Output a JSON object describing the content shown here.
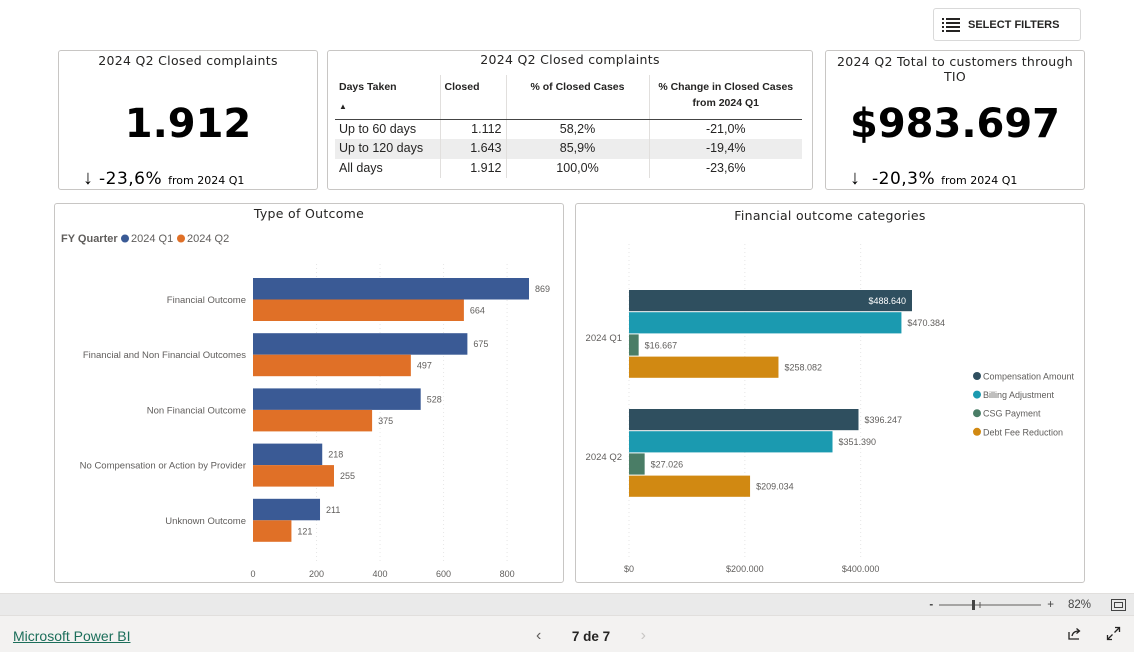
{
  "toolbar": {
    "filters_label": "SELECT FILTERS",
    "filters_icon": "list-icon"
  },
  "kpi_closed": {
    "title": "2024 Q2 Closed complaints",
    "value": "1.912",
    "arrow": "↓",
    "delta": "-23,6%",
    "from": "from 2024 Q1"
  },
  "table": {
    "title": "2024 Q2 Closed complaints",
    "headers": [
      "Days Taken",
      "Closed",
      "% of Closed Cases",
      "% Change in Closed Cases from 2024 Q1"
    ],
    "rows": [
      [
        "Up to 60 days",
        "1.112",
        "58,2%",
        "-21,0%"
      ],
      [
        "Up to 120 days",
        "1.643",
        "85,9%",
        "-19,4%"
      ],
      [
        "All days",
        "1.912",
        "100,0%",
        "-23,6%"
      ]
    ]
  },
  "kpi_tio": {
    "title": "2024 Q2 Total to customers through TIO",
    "value": "$983.697",
    "arrow": "↓",
    "delta": "-20,3%",
    "from": "from 2024 Q1"
  },
  "chart_data": [
    {
      "type": "bar",
      "orientation": "horizontal",
      "title": "Type of Outcome",
      "legend_title": "FY Quarter",
      "legend_position": "top-left",
      "categories": [
        "Financial Outcome",
        "Financial and Non Financial Outcomes",
        "Non Financial Outcome",
        "No Compensation or Action by Provider",
        "Unknown Outcome"
      ],
      "series": [
        {
          "name": "2024 Q1",
          "color": "#3a5a95",
          "values": [
            869,
            675,
            528,
            218,
            211
          ]
        },
        {
          "name": "2024 Q2",
          "color": "#e07027",
          "values": [
            664,
            497,
            375,
            255,
            121
          ]
        }
      ],
      "data_labels": [
        [
          "869",
          "675",
          "528",
          "218",
          "211"
        ],
        [
          "664",
          "497",
          "375",
          "255",
          "121"
        ]
      ],
      "xticks": [
        "0",
        "200",
        "400",
        "600",
        "800"
      ],
      "xtick_values": [
        0,
        200,
        400,
        600,
        800
      ],
      "xlim": [
        0,
        869
      ],
      "grid": true
    },
    {
      "type": "bar",
      "orientation": "horizontal",
      "title": "Financial outcome categories",
      "legend_position": "right",
      "categories": [
        "2024 Q1",
        "2024 Q2"
      ],
      "series": [
        {
          "name": "Compensation Amount",
          "color": "#2f4f5f",
          "values": [
            488640,
            396247
          ]
        },
        {
          "name": "Billing Adjustment",
          "color": "#1b9ab0",
          "values": [
            470384,
            351390
          ]
        },
        {
          "name": "CSG Payment",
          "color": "#4a7d66",
          "values": [
            16667,
            27026
          ]
        },
        {
          "name": "Debt Fee Reduction",
          "color": "#d18912",
          "values": [
            258082,
            209034
          ]
        }
      ],
      "data_labels": [
        [
          "$488.640",
          "$396.247"
        ],
        [
          "$470.384",
          "$351.390"
        ],
        [
          "$16.667",
          "$27.026"
        ],
        [
          "$258.082",
          "$209.034"
        ]
      ],
      "xticks": [
        "$0",
        "$200.000",
        "$400.000"
      ],
      "xtick_values": [
        0,
        200000,
        400000
      ],
      "xlim": [
        0,
        488640
      ],
      "grid": true
    }
  ],
  "zoom": {
    "minus": "-",
    "plus": "+",
    "level": "82%",
    "level_value": 82
  },
  "footer": {
    "brand": "Microsoft Power BI",
    "page_label": "7 de 7",
    "prev": "‹",
    "next": "›"
  }
}
